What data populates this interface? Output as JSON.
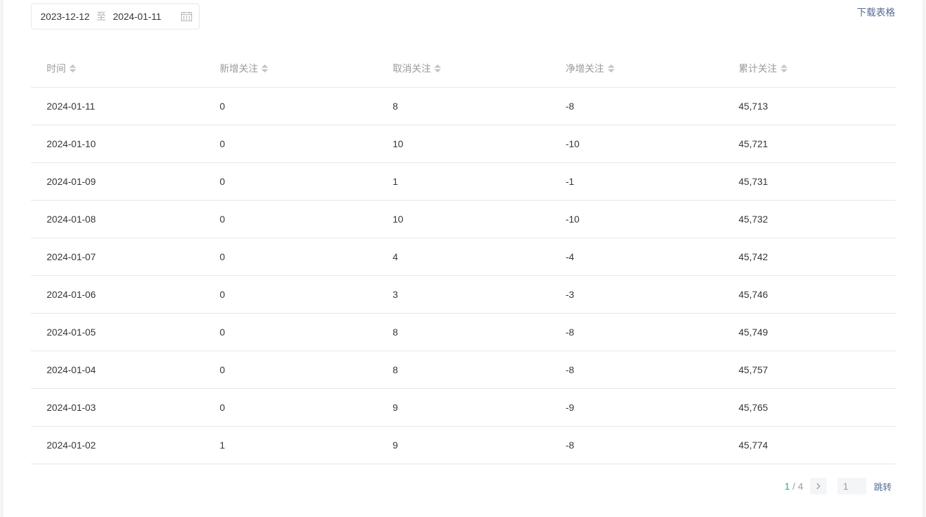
{
  "filter": {
    "start_date": "2023-12-12",
    "separator": "至",
    "end_date": "2024-01-11"
  },
  "actions": {
    "download_label": "下载表格"
  },
  "table": {
    "columns": [
      "时间",
      "新增关注",
      "取消关注",
      "净增关注",
      "累计关注"
    ],
    "rows": [
      [
        "2024-01-11",
        "0",
        "8",
        "-8",
        "45,713"
      ],
      [
        "2024-01-10",
        "0",
        "10",
        "-10",
        "45,721"
      ],
      [
        "2024-01-09",
        "0",
        "1",
        "-1",
        "45,731"
      ],
      [
        "2024-01-08",
        "0",
        "10",
        "-10",
        "45,732"
      ],
      [
        "2024-01-07",
        "0",
        "4",
        "-4",
        "45,742"
      ],
      [
        "2024-01-06",
        "0",
        "3",
        "-3",
        "45,746"
      ],
      [
        "2024-01-05",
        "0",
        "8",
        "-8",
        "45,749"
      ],
      [
        "2024-01-04",
        "0",
        "8",
        "-8",
        "45,757"
      ],
      [
        "2024-01-03",
        "0",
        "9",
        "-9",
        "45,765"
      ],
      [
        "2024-01-02",
        "1",
        "9",
        "-8",
        "45,774"
      ]
    ]
  },
  "pagination": {
    "current": "1",
    "separator": "/",
    "total": "4",
    "page_input_value": "1",
    "jump_label": "跳转"
  },
  "colors": {
    "accent_green": "#07c160",
    "link_blue": "#576b95",
    "text": "#353535",
    "muted": "#9a9a9a"
  },
  "icons": {
    "calendar": "calendar-icon",
    "sort": "sort-icon",
    "next": "chevron-right-icon"
  }
}
